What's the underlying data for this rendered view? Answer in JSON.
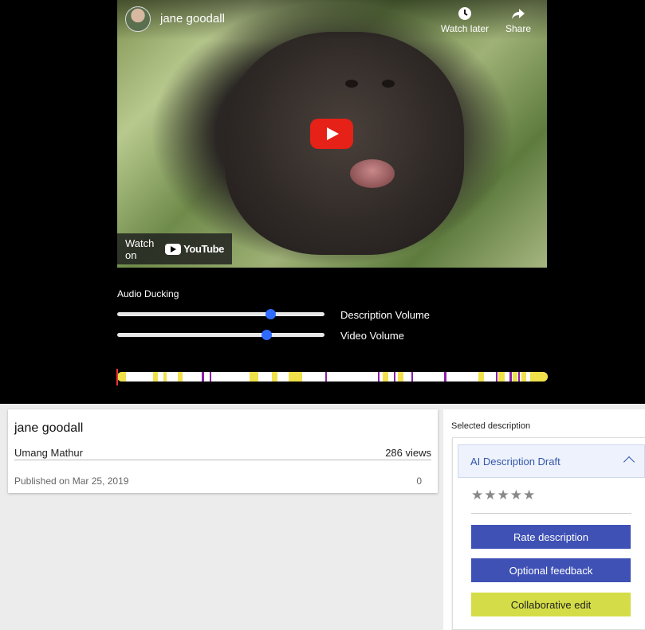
{
  "video": {
    "channel_title": "jane goodall",
    "watch_later_label": "Watch later",
    "share_label": "Share",
    "watch_on_label": "Watch on",
    "youtube_label": "YouTube"
  },
  "audio_ducking": {
    "label": "Audio Ducking",
    "description_volume": {
      "label": "Description Volume",
      "value": 0.74
    },
    "video_volume": {
      "label": "Video Volume",
      "value": 0.72
    }
  },
  "timeline": {
    "colors": {
      "inline": "#f0e04a",
      "extended": "#8a1fa8",
      "track": "#ffffff"
    },
    "segments": [
      {
        "type": "inline",
        "start": 0.0,
        "end": 0.02
      },
      {
        "type": "inline",
        "start": 0.083,
        "end": 0.095
      },
      {
        "type": "inline",
        "start": 0.107,
        "end": 0.115
      },
      {
        "type": "inline",
        "start": 0.14,
        "end": 0.152
      },
      {
        "type": "extended",
        "start": 0.197,
        "end": 0.201
      },
      {
        "type": "extended",
        "start": 0.215,
        "end": 0.219
      },
      {
        "type": "inline",
        "start": 0.307,
        "end": 0.327
      },
      {
        "type": "inline",
        "start": 0.36,
        "end": 0.372
      },
      {
        "type": "inline",
        "start": 0.398,
        "end": 0.43
      },
      {
        "type": "extended",
        "start": 0.483,
        "end": 0.487
      },
      {
        "type": "extended",
        "start": 0.606,
        "end": 0.61
      },
      {
        "type": "inline",
        "start": 0.616,
        "end": 0.63
      },
      {
        "type": "extended",
        "start": 0.643,
        "end": 0.647
      },
      {
        "type": "inline",
        "start": 0.652,
        "end": 0.664
      },
      {
        "type": "extended",
        "start": 0.683,
        "end": 0.687
      },
      {
        "type": "extended",
        "start": 0.76,
        "end": 0.764
      },
      {
        "type": "inline",
        "start": 0.838,
        "end": 0.852
      },
      {
        "type": "extended",
        "start": 0.88,
        "end": 0.884
      },
      {
        "type": "inline",
        "start": 0.886,
        "end": 0.9
      },
      {
        "type": "extended",
        "start": 0.912,
        "end": 0.916
      },
      {
        "type": "inline",
        "start": 0.918,
        "end": 0.93
      },
      {
        "type": "extended",
        "start": 0.932,
        "end": 0.936
      },
      {
        "type": "inline",
        "start": 0.938,
        "end": 0.95
      },
      {
        "type": "inline",
        "start": 0.96,
        "end": 1.0
      }
    ]
  },
  "info": {
    "title": "jane goodall",
    "author": "Umang Mathur",
    "views": "286 views",
    "published": "Published on Mar 25, 2019",
    "count": "0"
  },
  "selected_description": {
    "section_label": "Selected description",
    "card_title": "AI Description Draft",
    "stars": "★★★★★",
    "rate_button": "Rate description",
    "feedback_button": "Optional feedback",
    "collab_button": "Collaborative edit"
  },
  "colors": {
    "slider_thumb": "#2f6bff",
    "primary_button": "#3f51b5",
    "collab_button": "#d4dd47",
    "youtube_red": "#e62117"
  }
}
